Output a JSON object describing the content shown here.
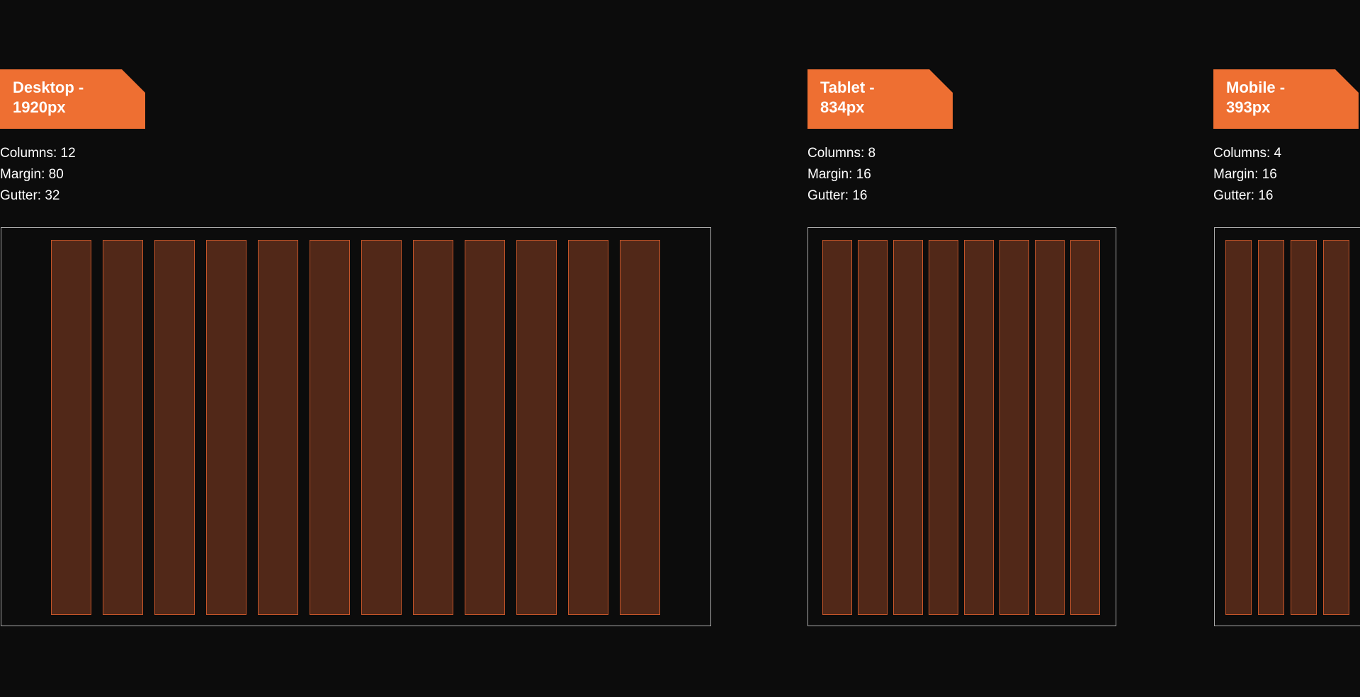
{
  "breakpoints": [
    {
      "key": "desktop",
      "label_line1": "Desktop -",
      "label_line2": "1920px",
      "columns_text": "Columns: 12",
      "margin_text": "Margin: 80",
      "gutter_text": "Gutter: 32",
      "columns": 12
    },
    {
      "key": "tablet",
      "label_line1": "Tablet -",
      "label_line2": "834px",
      "columns_text": "Columns: 8",
      "margin_text": "Margin: 16",
      "gutter_text": "Gutter: 16",
      "columns": 8
    },
    {
      "key": "mobile",
      "label_line1": "Mobile -",
      "label_line2": "393px",
      "columns_text": "Columns: 4",
      "margin_text": "Margin: 16",
      "gutter_text": "Gutter: 16",
      "columns": 4
    }
  ],
  "colors": {
    "background": "#0c0c0c",
    "tag": "#ee6f32",
    "column_fill": "#512818",
    "column_stroke": "#c55529",
    "frame_stroke": "#a9a9a9"
  }
}
